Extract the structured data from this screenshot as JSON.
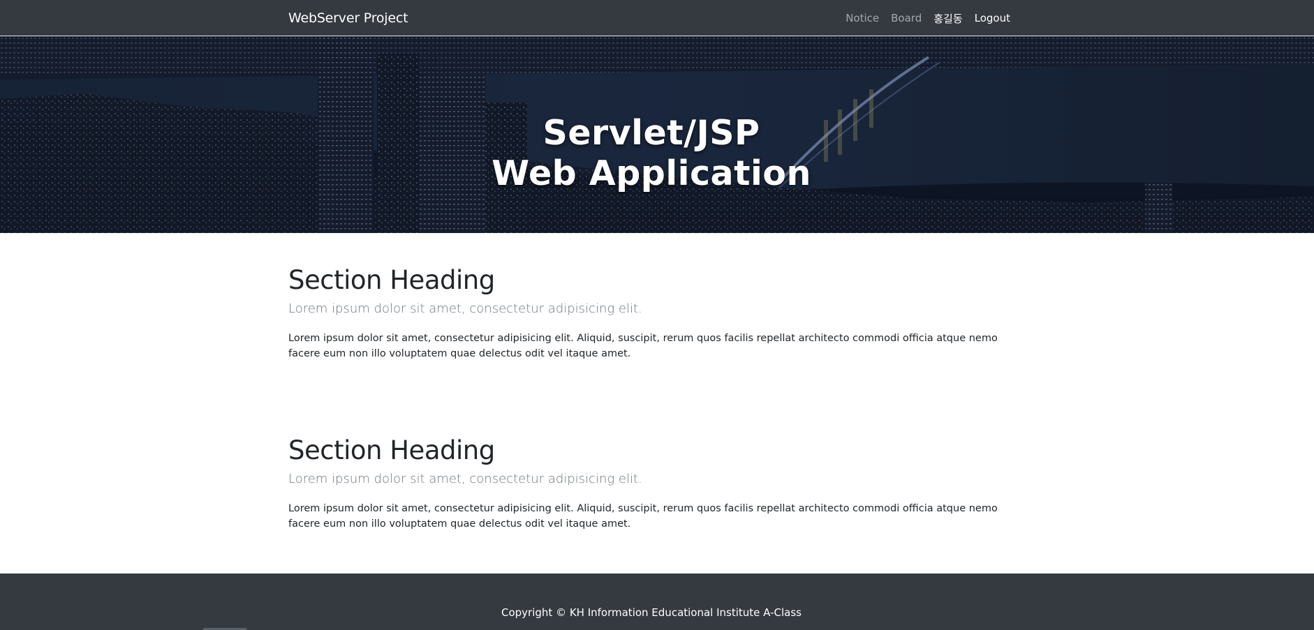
{
  "navbar": {
    "brand": "WebServer Project",
    "links": [
      {
        "label": "Notice"
      },
      {
        "label": "Board"
      },
      {
        "label": "홍길동"
      },
      {
        "label": "Logout"
      }
    ]
  },
  "hero": {
    "title_line1": "Servlet/JSP",
    "title_line2": "Web Application"
  },
  "sections": [
    {
      "heading": "Section Heading",
      "lead": "Lorem ipsum dolor sit amet, consectetur adipisicing elit.",
      "body": "Lorem ipsum dolor sit amet, consectetur adipisicing elit. Aliquid, suscipit, rerum quos facilis repellat architecto commodi officia atque nemo facere eum non illo voluptatem quae delectus odit vel itaque amet."
    },
    {
      "heading": "Section Heading",
      "lead": "Lorem ipsum dolor sit amet, consectetur adipisicing elit.",
      "body": "Lorem ipsum dolor sit amet, consectetur adipisicing elit. Aliquid, suscipit, rerum quos facilis repellat architecto commodi officia atque nemo facere eum non illo voluptatem quae delectus odit vel itaque amet."
    }
  ],
  "footer": {
    "copyright": "Copyright © KH Information Educational Institute A-Class"
  },
  "colors": {
    "navbar_bg": "#343a40",
    "footer_bg": "#343a40",
    "hero_overlay": "#0c1426"
  }
}
